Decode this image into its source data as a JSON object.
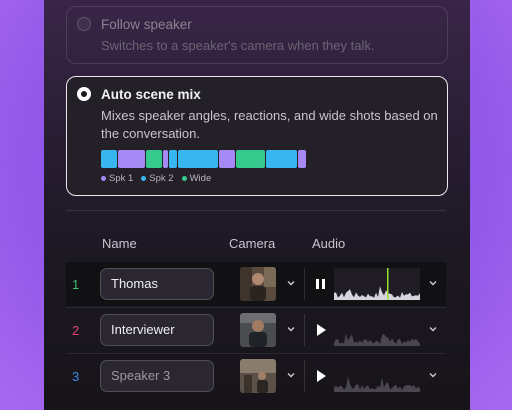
{
  "options": {
    "follow_speaker": {
      "title": "Follow speaker",
      "description": "Switches to a speaker's camera when they talk.",
      "selected": false
    },
    "auto_scene_mix": {
      "title": "Auto scene mix",
      "description": "Mixes speaker angles, reactions, and wide shots based on the conversation.",
      "selected": true,
      "mix_segments": [
        {
          "kind": "Spk 2",
          "share": 0.08
        },
        {
          "kind": "Spk 1",
          "share": 0.13
        },
        {
          "kind": "Wide",
          "share": 0.08
        },
        {
          "kind": "Spk 1",
          "share": 0.03
        },
        {
          "kind": "Spk 2",
          "share": 0.04
        },
        {
          "kind": "Spk 2",
          "share": 0.19
        },
        {
          "kind": "Spk 1",
          "share": 0.08
        },
        {
          "kind": "Wide",
          "share": 0.14
        },
        {
          "kind": "Spk 2",
          "share": 0.15
        },
        {
          "kind": "Spk 1",
          "share": 0.04
        }
      ],
      "legend": [
        {
          "label": "Spk 1",
          "color": "#a58af5"
        },
        {
          "label": "Spk 2",
          "color": "#38b6f0"
        },
        {
          "label": "Wide",
          "color": "#35c98d"
        }
      ]
    }
  },
  "table": {
    "headers": {
      "name": "Name",
      "camera": "Camera",
      "audio": "Audio"
    },
    "rows": [
      {
        "number": "1",
        "number_color": "#3fbf73",
        "name": "Thomas",
        "is_placeholder": false,
        "audio_state": "playing",
        "playhead": 0.62
      },
      {
        "number": "2",
        "number_color": "#e0407a",
        "name": "Interviewer",
        "is_placeholder": false,
        "audio_state": "paused"
      },
      {
        "number": "3",
        "number_color": "#3a8de0",
        "name": "Speaker 3",
        "is_placeholder": true,
        "audio_state": "paused"
      }
    ]
  },
  "colors": {
    "accent_playhead": "#9be02e",
    "selected_border": "#e9e6ee"
  },
  "icons": [
    "radio-icon",
    "chevron-down-icon",
    "pause-icon",
    "play-icon"
  ]
}
